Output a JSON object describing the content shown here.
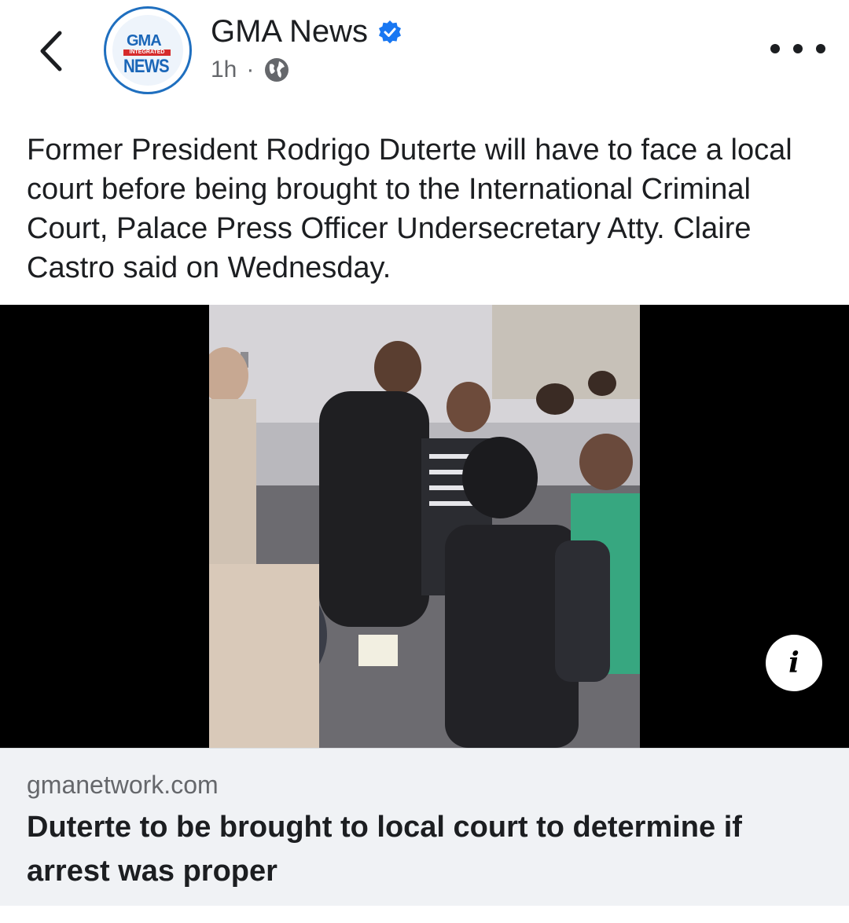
{
  "header": {
    "page_name": "GMA News",
    "time": "1h",
    "separator": "·",
    "logo": {
      "top_text": "GMA",
      "band_text": "INTEGRATED",
      "bottom_text": "NEWS"
    },
    "icons": {
      "back": "chevron-left-icon",
      "verified": "verified-badge-icon",
      "audience": "globe-icon",
      "more": "more-options-icon"
    },
    "colors": {
      "verified": "#1877f2",
      "brand": "#1a66b8"
    }
  },
  "post": {
    "caption": "Former President Rodrigo Duterte will have to face a local court before being brought to the International Criminal Court, Palace Press Officer Undersecretary Atty. Claire Castro said on Wednesday."
  },
  "media": {
    "info_icon": "i"
  },
  "link_card": {
    "domain": "gmanetwork.com",
    "title": "Duterte to be brought to local court to determine if arrest was proper"
  }
}
